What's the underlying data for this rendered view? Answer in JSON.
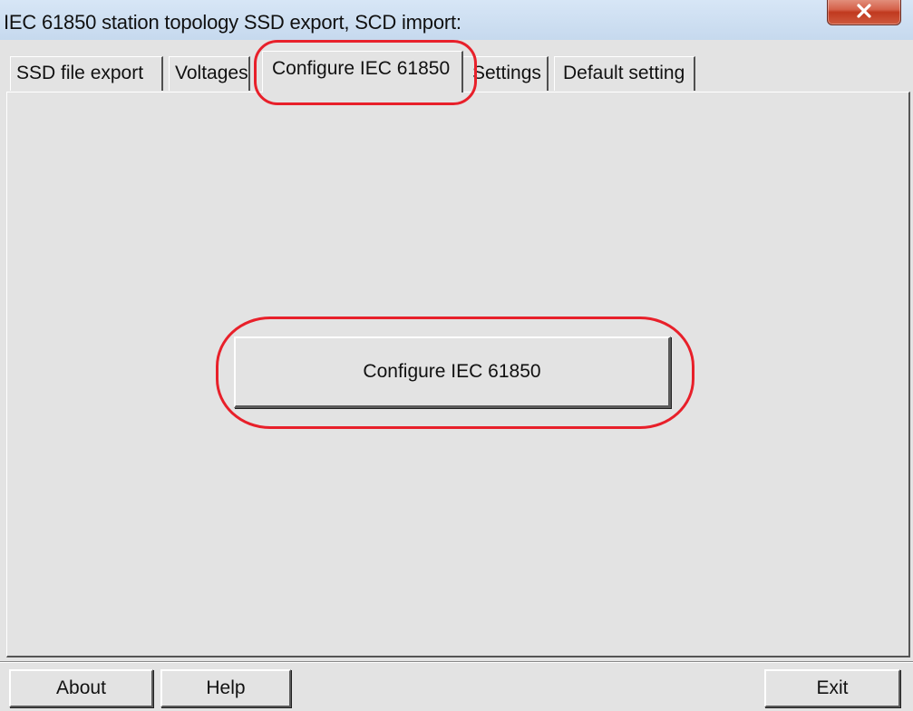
{
  "window": {
    "title": "IEC 61850 station topology SSD export, SCD import:",
    "close_icon": "close-icon",
    "close_button_color": "#c0391f"
  },
  "tabs": [
    {
      "label": "SSD file export",
      "active": false
    },
    {
      "label": "Voltages",
      "active": false
    },
    {
      "label": "Configure IEC 61850",
      "active": true
    },
    {
      "label": "Settings",
      "active": false
    },
    {
      "label": "Default setting",
      "active": false
    }
  ],
  "panel": {
    "configure_button_label": "Configure IEC 61850"
  },
  "footer": {
    "about_label": "About",
    "help_label": "Help",
    "exit_label": "Exit"
  },
  "annotation_color": "#e8202a"
}
